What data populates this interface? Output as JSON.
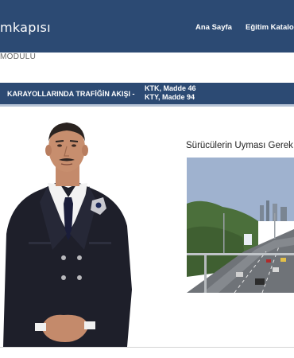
{
  "header": {
    "logo": "mkapısı",
    "nav_home": "Ana Sayfa",
    "nav_catalog": "Eğitim Katalo"
  },
  "module_label": "MODULU",
  "lesson": {
    "title": "KARAYOLLARINDA TRAFİĞİN AKIŞI -",
    "ref_1": "KTK, Madde 46",
    "ref_2": "KTY, Madde 94"
  },
  "slide": {
    "heading": "Sürücülerin Uyması Gerek"
  },
  "colors": {
    "header_bg": "#2c4a73",
    "lesson_bar_bg": "#2c4a73"
  }
}
